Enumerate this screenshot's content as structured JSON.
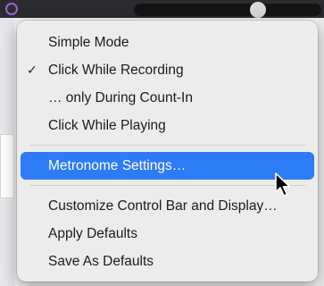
{
  "menu": {
    "group1": [
      {
        "label": "Simple Mode",
        "check": ""
      },
      {
        "label": "Click While Recording",
        "check": "✓"
      },
      {
        "label": "… only During Count-In",
        "check": ""
      },
      {
        "label": "Click While Playing",
        "check": ""
      }
    ],
    "group2": [
      {
        "label": "Metronome Settings…",
        "check": ""
      }
    ],
    "group3": [
      {
        "label": "Customize Control Bar and Display…",
        "check": ""
      },
      {
        "label": "Apply Defaults",
        "check": ""
      },
      {
        "label": "Save As Defaults",
        "check": ""
      }
    ],
    "highlighted_label": "Metronome Settings…"
  },
  "colors": {
    "highlight": "#2e7bf6",
    "menu_background": "#ececec",
    "accent_glyph": "#9b63d6"
  },
  "icons": {
    "checkmark": "checkmark-icon",
    "cursor": "arrow-cursor-icon"
  }
}
